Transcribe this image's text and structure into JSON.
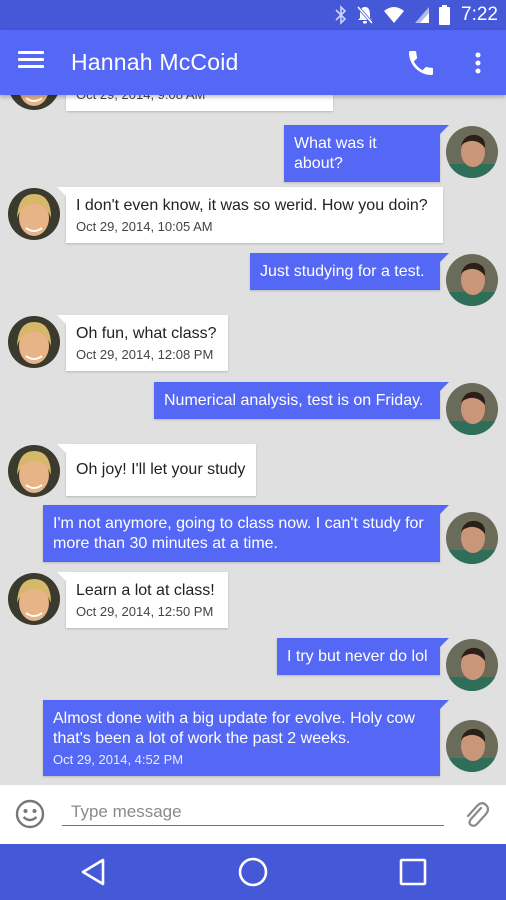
{
  "status_bar": {
    "time": "7:22"
  },
  "header": {
    "title": "Hannah McCoid"
  },
  "messages": [
    {
      "direction": "in",
      "text": "",
      "time": "Oct 29, 2014, 9:08 AM"
    },
    {
      "direction": "out",
      "text": "What was it about?",
      "time": ""
    },
    {
      "direction": "in",
      "text": "I don't even know, it was so werid. How you doin?",
      "time": "Oct 29, 2014, 10:05 AM"
    },
    {
      "direction": "out",
      "text": "Just studying for a test.",
      "time": ""
    },
    {
      "direction": "in",
      "text": "Oh fun, what class?",
      "time": "Oct 29, 2014, 12:08 PM"
    },
    {
      "direction": "out",
      "text": "Numerical analysis, test is on Friday.",
      "time": ""
    },
    {
      "direction": "in",
      "text": "Oh joy! I'll let your study",
      "time": ""
    },
    {
      "direction": "out",
      "text": "I'm not anymore, going to class now. I can't study for more than 30 minutes at a time.",
      "time": ""
    },
    {
      "direction": "in",
      "text": "Learn a lot at class!",
      "time": "Oct 29, 2014, 12:50 PM"
    },
    {
      "direction": "out",
      "text": "I try but never do lol",
      "time": ""
    },
    {
      "direction": "out",
      "text": "Almost done with a big update for evolve. Holy cow that's been a lot of work the past 2 weeks.",
      "time": "Oct 29, 2014, 4:52 PM"
    }
  ],
  "composer": {
    "placeholder": "Type message"
  },
  "colors": {
    "primary": "#5468f5",
    "primary_dark": "#4558d8",
    "background": "#e0e0e0"
  },
  "icons": {
    "status": [
      "bluetooth-icon",
      "notifications-off-icon",
      "wifi-icon",
      "cell-signal-icon",
      "battery-icon"
    ],
    "header": [
      "menu-icon",
      "phone-icon",
      "more-vert-icon"
    ],
    "composer": [
      "emoji-icon",
      "attach-icon"
    ],
    "nav": [
      "back-icon",
      "home-icon",
      "recents-icon"
    ]
  }
}
